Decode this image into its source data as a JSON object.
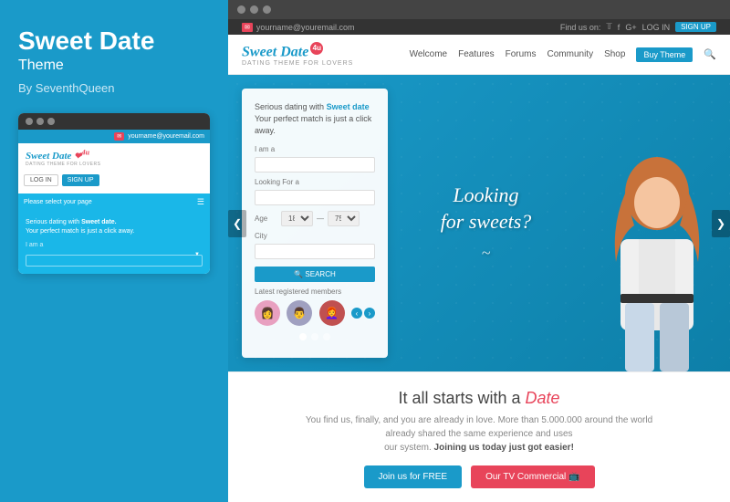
{
  "leftPanel": {
    "brandTitle": "Sweet Date",
    "brandSubtitle": "Theme",
    "brandAuthor": "By SeventhQueen",
    "miniDots": [
      "●",
      "●",
      "●"
    ],
    "miniEmail": "yourname@youremail.com",
    "miniLogoText": "Sweet Date",
    "miniLogoNum": "4u",
    "miniTagline": "DATING THEME FOR LOVERS",
    "loginBtn": "LOG IN",
    "signupBtn": "SIGN UP",
    "selectPage": "Please select your page",
    "bodyText": "Serious dating with",
    "bodyTextBold": "Sweet date.",
    "bodyText2": "Your perfect match is just a click away.",
    "iAmLabel": "I am a"
  },
  "rightPanel": {
    "chromeDots": [
      "●",
      "●",
      "●"
    ],
    "topBar": {
      "email": "yourname@youremail.com",
      "findUs": "Find us on:",
      "login": "LOG IN",
      "signup": "SIGN UP"
    },
    "nav": {
      "logoText": "Sweet Date",
      "logoNum": "4u",
      "logoTagline": "DATING THEME FOR LOVERS",
      "links": [
        "Welcome",
        "Features",
        "Forums",
        "Community",
        "Shop"
      ],
      "buyTheme": "Buy Theme",
      "searchIcon": "🔍"
    },
    "hero": {
      "searchBox": {
        "title": "Serious dating with",
        "titleBold": "Sweet date",
        "subtitle": "Your perfect match is just a click away.",
        "iAmLabel": "I am a",
        "lookingForLabel": "Looking For a",
        "ageLabel": "Age",
        "ageFrom": "18",
        "ageTo": "75",
        "cityLabel": "City",
        "searchBtn": "🔍 SEARCH",
        "membersLabel": "Latest registered members"
      },
      "tagline": "Looking",
      "tagline2": "for sweets?",
      "prevArrow": "❮",
      "nextArrow": "❯",
      "dots": [
        true,
        false,
        false
      ]
    },
    "bottom": {
      "title": "It all starts with a",
      "titleDate": "Date",
      "desc1": "You find us, finally, and you are already in love. More than 5.000.000 around the world already shared the same experience and uses",
      "desc2": "our system.",
      "descBold": "Joining us today just got easier!",
      "joinBtn": "Join us for FREE",
      "tvBtn": "Our TV Commercial 📺"
    }
  }
}
